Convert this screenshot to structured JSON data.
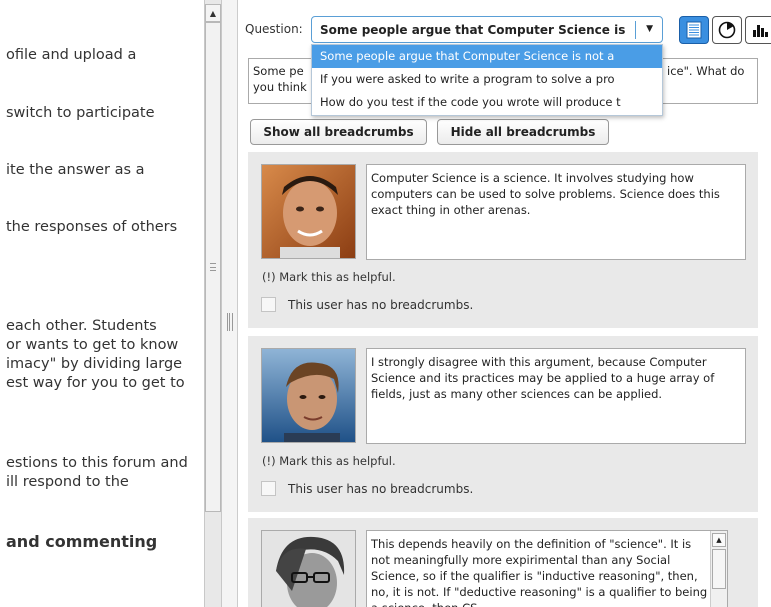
{
  "left_panel": {
    "lines": [
      "ofile and upload a",
      " switch to participate",
      "ite the answer as a",
      " the responses of others",
      " each other. Students",
      " or wants to get to know",
      "imacy\" by dividing large",
      "est way for you to get to",
      "estions to this forum and",
      "ill respond to the"
    ],
    "heading": " and commenting"
  },
  "question": {
    "label": "Question:",
    "selected_value": "Some people argue that Computer Science is",
    "options": [
      "Some people argue that Computer Science is not a",
      "If you were asked to write a program to solve a pro",
      "How do you test if the code you wrote will produce t"
    ],
    "text_left_1": "Some pe",
    "text_left_2": "you think",
    "text_right_1": "ice\". What do"
  },
  "view_modes": {
    "list_icon": "list-icon",
    "pie_icon": "pie-chart-icon",
    "bar_icon": "bar-chart-icon",
    "accent": "#3a8fe0"
  },
  "buttons": {
    "show_all": "Show all breadcrumbs",
    "hide_all": "Hide all breadcrumbs"
  },
  "responses": [
    {
      "text": "Computer Science is a science.  It involves studying how computers can be used to solve problems.  Science does this exact thing in other arenas.",
      "helpful": "(!) Mark this as helpful.",
      "breadcrumbs": "This user has no breadcrumbs."
    },
    {
      "text": "I strongly disagree with this argument, because Computer Science and its practices may be applied to a huge array of fields, just as many other sciences can be applied.",
      "helpful": "(!) Mark this as helpful.",
      "breadcrumbs": "This user has no breadcrumbs."
    },
    {
      "text": "This depends heavily on the definition of \"science\". It is not meaningfully more expirimental than any Social Science, so if the qualifier is \"inductive reasoning\", then, no, it is not. If \"deductive reasoning\" is a qualifier to being a science, then CS"
    }
  ]
}
